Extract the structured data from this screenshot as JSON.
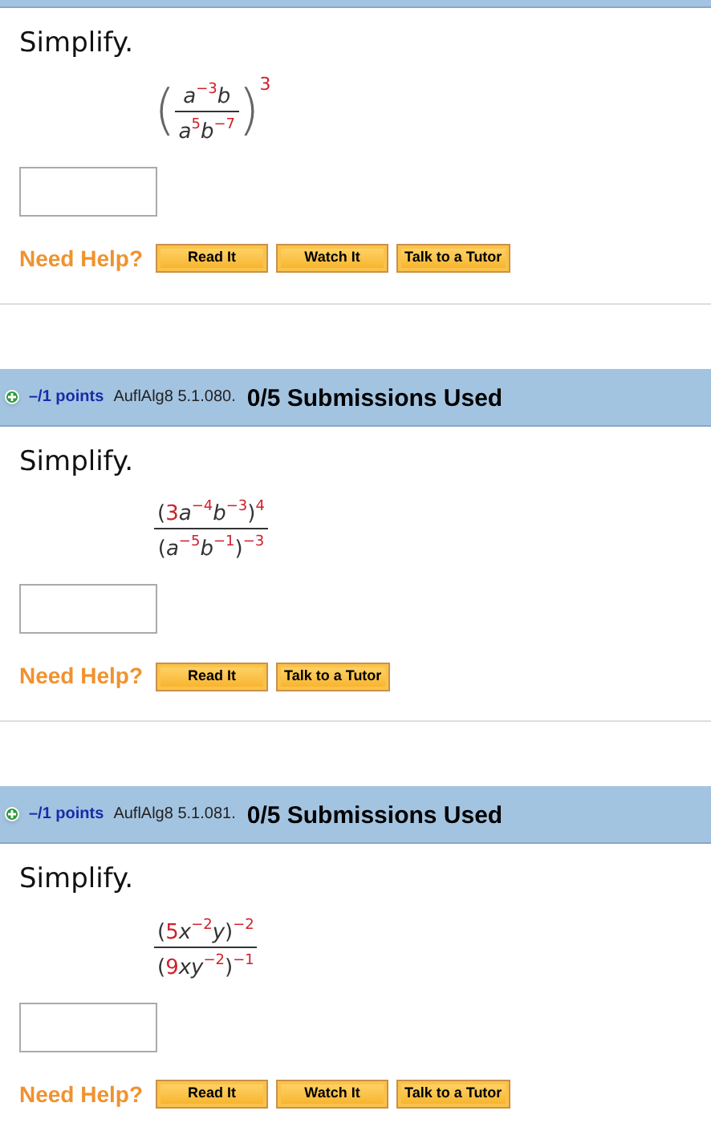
{
  "problems": [
    {
      "prompt": "Simplify.",
      "expression": {
        "open": "(",
        "close": ")",
        "outer_exponent": "3",
        "numerator": [
          {
            "kind": "var",
            "text": "a"
          },
          {
            "kind": "exp",
            "text": "−3"
          },
          {
            "kind": "var",
            "text": "b"
          }
        ],
        "denominator": [
          {
            "kind": "var",
            "text": "a"
          },
          {
            "kind": "exp",
            "text": "5"
          },
          {
            "kind": "var",
            "text": "b"
          },
          {
            "kind": "exp",
            "text": "−7"
          }
        ]
      },
      "help_label": "Need Help?",
      "buttons": [
        "Read It",
        "Watch It",
        "Talk to a Tutor"
      ]
    },
    {
      "header": {
        "points": "–/1 points",
        "code": "AuflAlg8 5.1.080.",
        "submissions": "0/5 Submissions Used"
      },
      "prompt": "Simplify.",
      "expression": {
        "numerator": [
          {
            "kind": "sym",
            "text": "("
          },
          {
            "kind": "coef",
            "text": "3"
          },
          {
            "kind": "var",
            "text": "a"
          },
          {
            "kind": "exp",
            "text": "−4"
          },
          {
            "kind": "var",
            "text": "b"
          },
          {
            "kind": "exp",
            "text": "−3"
          },
          {
            "kind": "sym",
            "text": ")"
          },
          {
            "kind": "exp",
            "text": "4"
          }
        ],
        "denominator": [
          {
            "kind": "sym",
            "text": "("
          },
          {
            "kind": "var",
            "text": "a"
          },
          {
            "kind": "exp",
            "text": "−5"
          },
          {
            "kind": "var",
            "text": "b"
          },
          {
            "kind": "exp",
            "text": "−1"
          },
          {
            "kind": "sym",
            "text": ")"
          },
          {
            "kind": "exp",
            "text": "−3"
          }
        ]
      },
      "help_label": "Need Help?",
      "buttons": [
        "Read It",
        "Talk to a Tutor"
      ]
    },
    {
      "header": {
        "points": "–/1 points",
        "code": "AuflAlg8 5.1.081.",
        "submissions": "0/5 Submissions Used"
      },
      "prompt": "Simplify.",
      "expression": {
        "numerator": [
          {
            "kind": "sym",
            "text": "("
          },
          {
            "kind": "coef",
            "text": "5"
          },
          {
            "kind": "var",
            "text": "x"
          },
          {
            "kind": "exp",
            "text": "−2"
          },
          {
            "kind": "var",
            "text": "y"
          },
          {
            "kind": "sym",
            "text": ")"
          },
          {
            "kind": "exp",
            "text": "−2"
          }
        ],
        "denominator": [
          {
            "kind": "sym",
            "text": "("
          },
          {
            "kind": "coef",
            "text": "9"
          },
          {
            "kind": "var",
            "text": "xy"
          },
          {
            "kind": "exp",
            "text": "−2"
          },
          {
            "kind": "sym",
            "text": ")"
          },
          {
            "kind": "exp",
            "text": "−1"
          }
        ]
      },
      "help_label": "Need Help?",
      "buttons": [
        "Read It",
        "Watch It",
        "Talk to a Tutor"
      ]
    }
  ]
}
